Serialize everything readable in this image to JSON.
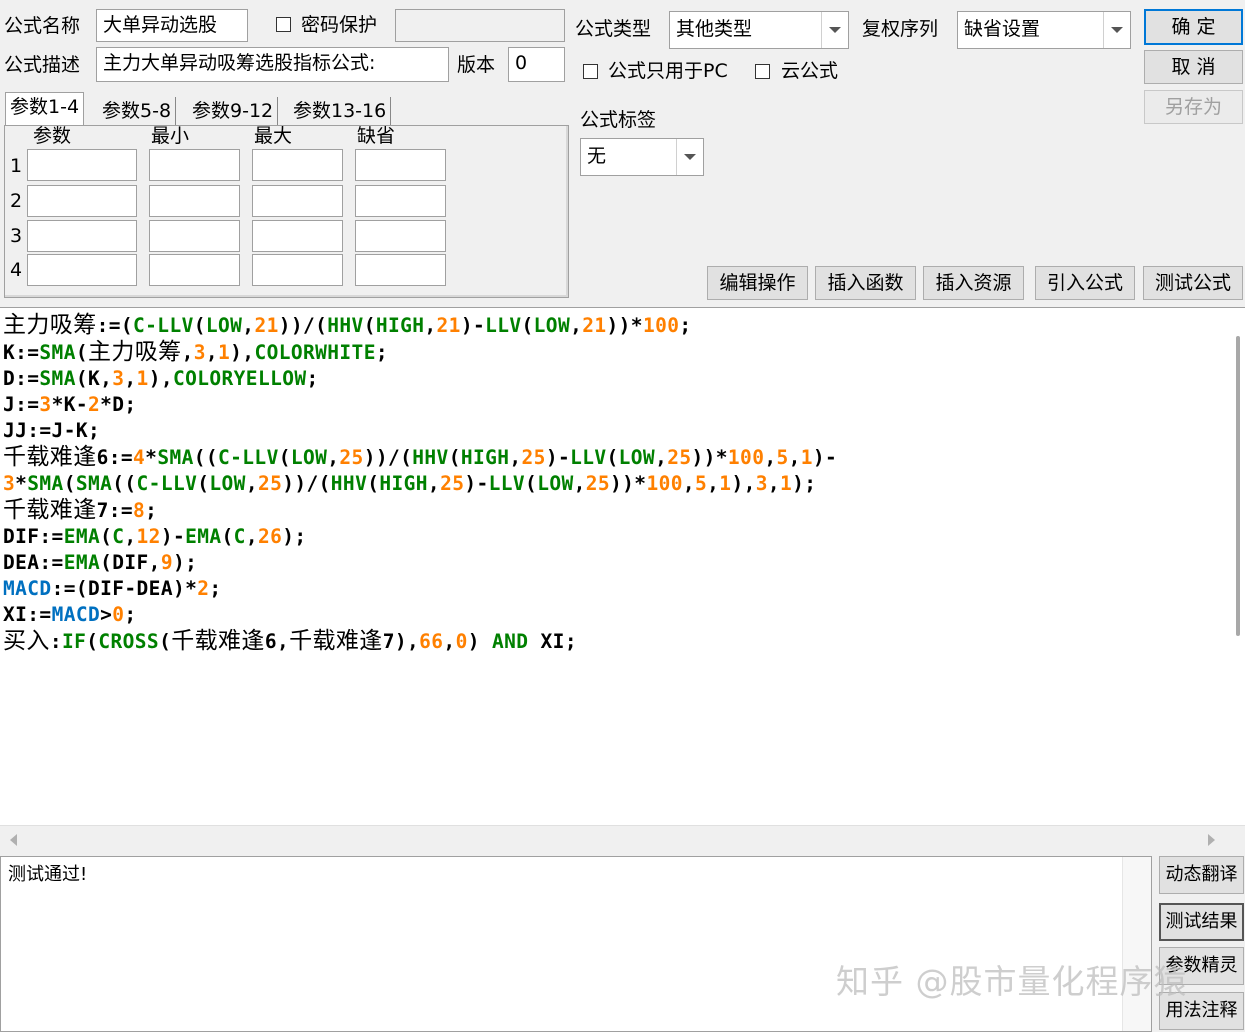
{
  "form": {
    "name_label": "公式名称",
    "name_value": "大单异动选股",
    "password_label": "密码保护",
    "desc_label": "公式描述",
    "desc_value": "主力大单异动吸筹选股指标公式:",
    "version_label": "版本",
    "version_value": "0",
    "type_label": "公式类型",
    "type_value": "其他类型",
    "rights_label": "复权序列",
    "rights_value": "缺省设置",
    "pc_only_label": "公式只用于PC",
    "cloud_label": "云公式",
    "tag_label": "公式标签",
    "tag_value": "无"
  },
  "buttons": {
    "ok": "确  定",
    "cancel": "取  消",
    "save_as": "另存为"
  },
  "param_tabs": [
    "参数1-4",
    "参数5-8",
    "参数9-12",
    "参数13-16"
  ],
  "param_table": {
    "headers": [
      "参数",
      "最小",
      "最大",
      "缺省"
    ],
    "rows": [
      "1",
      "2",
      "3",
      "4"
    ]
  },
  "toolbar": [
    "编辑操作",
    "插入函数",
    "插入资源",
    "引入公式",
    "测试公式"
  ],
  "code_lines": [
    [
      [
        "t",
        "主力吸筹"
      ],
      [
        "p",
        ":=("
      ],
      [
        "f",
        "C-LLV"
      ],
      [
        "p",
        "("
      ],
      [
        "f",
        "LOW"
      ],
      [
        "p",
        ","
      ],
      [
        "n",
        "21"
      ],
      [
        "p",
        "))/("
      ],
      [
        "f",
        "HHV"
      ],
      [
        "p",
        "("
      ],
      [
        "f",
        "HIGH"
      ],
      [
        "p",
        ","
      ],
      [
        "n",
        "21"
      ],
      [
        "p",
        ")-"
      ],
      [
        "f",
        "LLV"
      ],
      [
        "p",
        "("
      ],
      [
        "f",
        "LOW"
      ],
      [
        "p",
        ","
      ],
      [
        "n",
        "21"
      ],
      [
        "p",
        "))*"
      ],
      [
        "n",
        "100"
      ],
      [
        "p",
        ";"
      ]
    ],
    [
      [
        "p",
        "K:="
      ],
      [
        "f",
        "SMA"
      ],
      [
        "p",
        "("
      ],
      [
        "t",
        "主力吸筹"
      ],
      [
        "p",
        ","
      ],
      [
        "n",
        "3"
      ],
      [
        "p",
        ","
      ],
      [
        "n",
        "1"
      ],
      [
        "p",
        "),"
      ],
      [
        "f",
        "COLORWHITE"
      ],
      [
        "p",
        ";"
      ]
    ],
    [
      [
        "p",
        "D:="
      ],
      [
        "f",
        "SMA"
      ],
      [
        "p",
        "(K,"
      ],
      [
        "n",
        "3"
      ],
      [
        "p",
        ","
      ],
      [
        "n",
        "1"
      ],
      [
        "p",
        "),"
      ],
      [
        "f",
        "COLORYELLOW"
      ],
      [
        "p",
        ";"
      ]
    ],
    [
      [
        "p",
        "J:="
      ],
      [
        "n",
        "3"
      ],
      [
        "p",
        "*K-"
      ],
      [
        "n",
        "2"
      ],
      [
        "p",
        "*D;"
      ]
    ],
    [
      [
        "p",
        "JJ:=J-K;"
      ]
    ],
    [
      [
        "t",
        "千载难逢"
      ],
      [
        "p",
        "6:="
      ],
      [
        "n",
        "4"
      ],
      [
        "p",
        "*"
      ],
      [
        "f",
        "SMA"
      ],
      [
        "p",
        "(("
      ],
      [
        "f",
        "C-LLV"
      ],
      [
        "p",
        "("
      ],
      [
        "f",
        "LOW"
      ],
      [
        "p",
        ","
      ],
      [
        "n",
        "25"
      ],
      [
        "p",
        "))/("
      ],
      [
        "f",
        "HHV"
      ],
      [
        "p",
        "("
      ],
      [
        "f",
        "HIGH"
      ],
      [
        "p",
        ","
      ],
      [
        "n",
        "25"
      ],
      [
        "p",
        ")-"
      ],
      [
        "f",
        "LLV"
      ],
      [
        "p",
        "("
      ],
      [
        "f",
        "LOW"
      ],
      [
        "p",
        ","
      ],
      [
        "n",
        "25"
      ],
      [
        "p",
        "))*"
      ],
      [
        "n",
        "100"
      ],
      [
        "p",
        ","
      ],
      [
        "n",
        "5"
      ],
      [
        "p",
        ","
      ],
      [
        "n",
        "1"
      ],
      [
        "p",
        ")-"
      ]
    ],
    [
      [
        "n",
        "3"
      ],
      [
        "p",
        "*"
      ],
      [
        "f",
        "SMA"
      ],
      [
        "p",
        "("
      ],
      [
        "f",
        "SMA"
      ],
      [
        "p",
        "(("
      ],
      [
        "f",
        "C-LLV"
      ],
      [
        "p",
        "("
      ],
      [
        "f",
        "LOW"
      ],
      [
        "p",
        ","
      ],
      [
        "n",
        "25"
      ],
      [
        "p",
        "))/("
      ],
      [
        "f",
        "HHV"
      ],
      [
        "p",
        "("
      ],
      [
        "f",
        "HIGH"
      ],
      [
        "p",
        ","
      ],
      [
        "n",
        "25"
      ],
      [
        "p",
        ")-"
      ],
      [
        "f",
        "LLV"
      ],
      [
        "p",
        "("
      ],
      [
        "f",
        "LOW"
      ],
      [
        "p",
        ","
      ],
      [
        "n",
        "25"
      ],
      [
        "p",
        "))*"
      ],
      [
        "n",
        "100"
      ],
      [
        "p",
        ","
      ],
      [
        "n",
        "5"
      ],
      [
        "p",
        ","
      ],
      [
        "n",
        "1"
      ],
      [
        "p",
        "),"
      ],
      [
        "n",
        "3"
      ],
      [
        "p",
        ","
      ],
      [
        "n",
        "1"
      ],
      [
        "p",
        ");"
      ]
    ],
    [
      [
        "t",
        "千载难逢"
      ],
      [
        "p",
        "7:="
      ],
      [
        "n",
        "8"
      ],
      [
        "p",
        ";"
      ]
    ],
    [
      [
        "p",
        "DIF:="
      ],
      [
        "f",
        "EMA"
      ],
      [
        "p",
        "("
      ],
      [
        "f",
        "C"
      ],
      [
        "p",
        ","
      ],
      [
        "n",
        "12"
      ],
      [
        "p",
        ")-"
      ],
      [
        "f",
        "EMA"
      ],
      [
        "p",
        "("
      ],
      [
        "f",
        "C"
      ],
      [
        "p",
        ","
      ],
      [
        "n",
        "26"
      ],
      [
        "p",
        ");"
      ]
    ],
    [
      [
        "p",
        "DEA:="
      ],
      [
        "f",
        "EMA"
      ],
      [
        "p",
        "(DIF,"
      ],
      [
        "n",
        "9"
      ],
      [
        "p",
        ");"
      ]
    ],
    [
      [
        "k",
        "MACD"
      ],
      [
        "p",
        ":=(DIF-DEA)*"
      ],
      [
        "n",
        "2"
      ],
      [
        "p",
        ";"
      ]
    ],
    [
      [
        "p",
        "XI:="
      ],
      [
        "k",
        "MACD"
      ],
      [
        "p",
        ">"
      ],
      [
        "n",
        "0"
      ],
      [
        "p",
        ";"
      ]
    ],
    [
      [
        "t",
        "买入"
      ],
      [
        "p",
        ":"
      ],
      [
        "f",
        "IF"
      ],
      [
        "p",
        "("
      ],
      [
        "f",
        "CROSS"
      ],
      [
        "p",
        "("
      ],
      [
        "t",
        "千载难逢"
      ],
      [
        "p",
        "6,"
      ],
      [
        "t",
        "千载难逢"
      ],
      [
        "p",
        "7),"
      ],
      [
        "n",
        "66"
      ],
      [
        "p",
        ","
      ],
      [
        "n",
        "0"
      ],
      [
        "p",
        ") "
      ],
      [
        "f",
        "AND"
      ],
      [
        "p",
        " XI;"
      ]
    ]
  ],
  "output_text": "测试通过!",
  "side_buttons": [
    "动态翻译",
    "测试结果",
    "参数精灵",
    "用法注释"
  ],
  "watermark": "知乎 @股市量化程序猿",
  "colors": {
    "function": "#008000",
    "number": "#ff8000",
    "keyword": "#0070c0",
    "primary_border": "#0078d7"
  }
}
